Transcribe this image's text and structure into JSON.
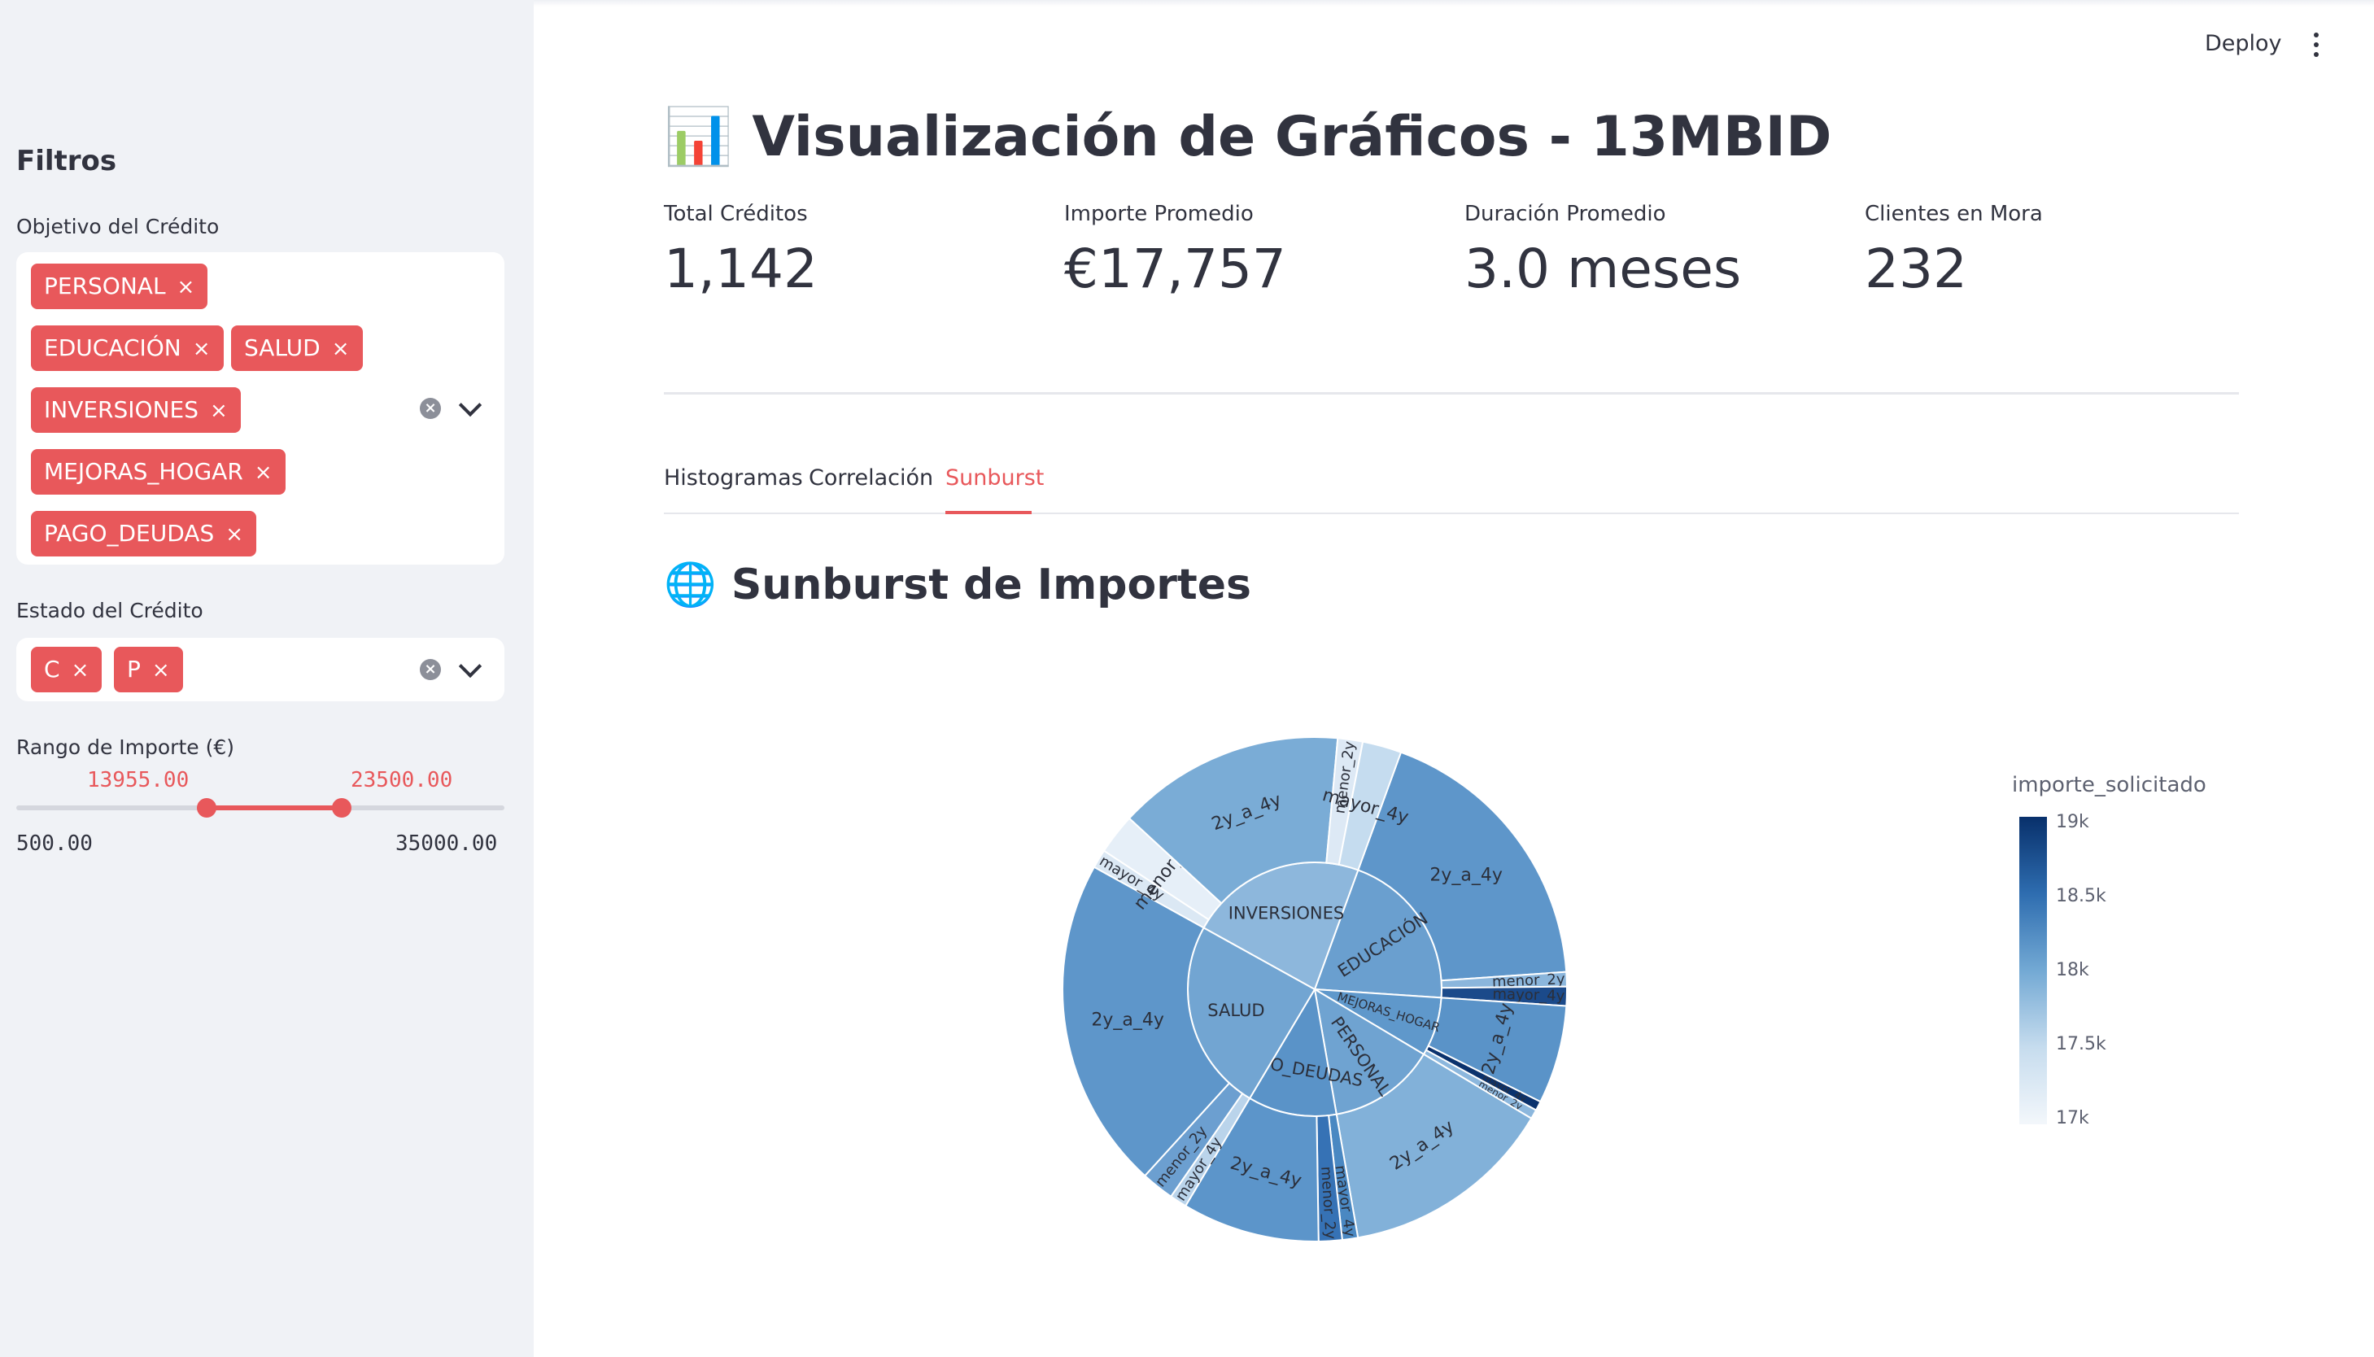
{
  "header": {
    "deploy_label": "Deploy"
  },
  "sidebar": {
    "title": "Filtros",
    "objetivo": {
      "label": "Objetivo del Crédito",
      "chips": [
        "PERSONAL",
        "EDUCACIÓN",
        "SALUD",
        "INVERSIONES",
        "MEJORAS_HOGAR",
        "PAGO_DEUDAS"
      ]
    },
    "estado": {
      "label": "Estado del Crédito",
      "chips": [
        "C",
        "P"
      ]
    },
    "rango": {
      "label": "Rango de Importe (€)",
      "low_value": "13955.00",
      "high_value": "23500.00",
      "min_label": "500.00",
      "max_label": "35000.00",
      "min": 500,
      "max": 35000,
      "low": 13955,
      "high": 23500
    },
    "chip_remove_glyph": "×"
  },
  "main": {
    "title_icon": "📊",
    "title": "Visualización de Gráficos - 13MBID",
    "metrics": [
      {
        "label": "Total Créditos",
        "value": "1,142"
      },
      {
        "label": "Importe Promedio",
        "value": "€17,757"
      },
      {
        "label": "Duración Promedio",
        "value": "3.0 meses"
      },
      {
        "label": "Clientes en Mora",
        "value": "232"
      }
    ],
    "tabs": [
      {
        "label": "Histogramas",
        "active": false
      },
      {
        "label": "Correlación",
        "active": false
      },
      {
        "label": "Sunburst",
        "active": true
      }
    ],
    "section_icon": "🌐",
    "section_title": "Sunburst de Importes"
  },
  "chart_data": {
    "type": "sunburst",
    "colorbar": {
      "title": "importe_solicitado",
      "ticks": [
        "19k",
        "18.5k",
        "18k",
        "17.5k",
        "17k"
      ],
      "min": 17000,
      "max": 19000,
      "colors": [
        "#f3f7fb",
        "#08306b"
      ]
    },
    "inner": [
      {
        "label": "EDUCACIÓN",
        "weight": 20.5,
        "color": "#6a9fcf",
        "children": [
          {
            "label": "2y_a_4y",
            "weight": 17.9,
            "color": "#5e96ca"
          },
          {
            "label": "menor_2y",
            "weight": 0.9,
            "color": "#8bb6dc"
          },
          {
            "label": "mayor_4y",
            "weight": 1.2,
            "color": "#1b4a8a"
          }
        ]
      },
      {
        "label": "MEJORAS_HOGAR",
        "weight": 7.5,
        "color": "#5f98cb",
        "children": [
          {
            "label": "2y_a_4y",
            "weight": 6.3,
            "color": "#5a93c8"
          },
          {
            "label": "mayor_4y",
            "weight": 0.6,
            "color": "#0b326d"
          },
          {
            "label": "menor_2y",
            "weight": 0.6,
            "color": "#8cb7dd"
          }
        ]
      },
      {
        "label": "PERSONAL",
        "weight": 13.7,
        "color": "#6fa3d1",
        "children": [
          {
            "label": "2y_a_4y",
            "weight": 13.7,
            "color": "#82b1d9"
          }
        ]
      },
      {
        "label": "PAGO_DEUDAS",
        "weight": 11.3,
        "color": "#5a93c8",
        "children": [
          {
            "label": "mayor_4y",
            "weight": 1.0,
            "color": "#4a88c2"
          },
          {
            "label": "menor_2y",
            "weight": 1.5,
            "color": "#3672b5"
          },
          {
            "label": "2y_a_4y",
            "weight": 8.8,
            "color": "#5c95ca"
          }
        ]
      },
      {
        "label": "SALUD",
        "weight": 24.5,
        "color": "#72a5d2",
        "children": [
          {
            "label": "mayor_4y",
            "weight": 1.1,
            "color": "#bad4eb"
          },
          {
            "label": "menor_2y",
            "weight": 2.1,
            "color": "#6c9fd0"
          },
          {
            "label": "2y_a_4y",
            "weight": 21.3,
            "color": "#5e96ca"
          }
        ]
      },
      {
        "label": "INVERSIONES",
        "weight": 22.5,
        "color": "#8db7dc",
        "children": [
          {
            "label": "mayor_4y",
            "weight": 1.2,
            "color": "#dbe8f4"
          },
          {
            "label": "menor_2y",
            "weight": 2.6,
            "color": "#e6eff8"
          },
          {
            "label": "2y_a_4y",
            "weight": 14.6,
            "color": "#7aacd6"
          },
          {
            "label": "menor_2y",
            "weight": 1.6,
            "color": "#dde9f5"
          },
          {
            "label": "mayor_4y",
            "weight": 2.5,
            "color": "#c5dcef"
          }
        ]
      }
    ]
  }
}
